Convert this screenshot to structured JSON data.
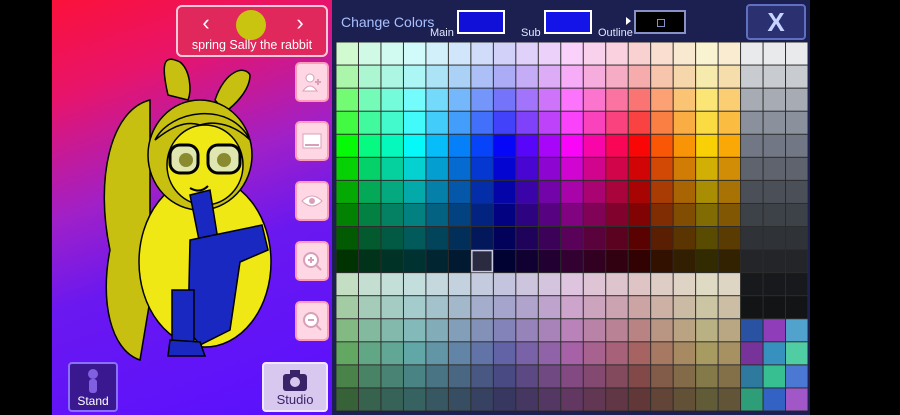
{
  "character": {
    "name": "spring Sally the rabbit",
    "prev_icon": "chevron-left-icon",
    "next_icon": "chevron-right-icon",
    "colors": {
      "hair": "#c8c010",
      "skin": "#f0e814",
      "outfit": "#1828c0",
      "outline": "#000000"
    }
  },
  "side_buttons": [
    {
      "name": "add-character-button",
      "icon": "add-person-icon"
    },
    {
      "name": "background-button",
      "icon": "image-icon"
    },
    {
      "name": "view-button",
      "icon": "eye-icon"
    },
    {
      "name": "zoom-in-button",
      "icon": "zoom-in-icon"
    },
    {
      "name": "zoom-out-button",
      "icon": "zoom-out-icon"
    }
  ],
  "bottom": {
    "stand_label": "Stand",
    "studio_label": "Studio",
    "studio_icon": "camera-icon"
  },
  "color_panel": {
    "title": "Change Colors",
    "main_label": "Main",
    "sub_label": "Sub",
    "outline_label": "Outline",
    "close_label": "X",
    "main_color": "#1010d8",
    "sub_color": "#1414e8",
    "outline_color": "#000000",
    "selected_cell": {
      "col": 6,
      "row": 9
    }
  }
}
